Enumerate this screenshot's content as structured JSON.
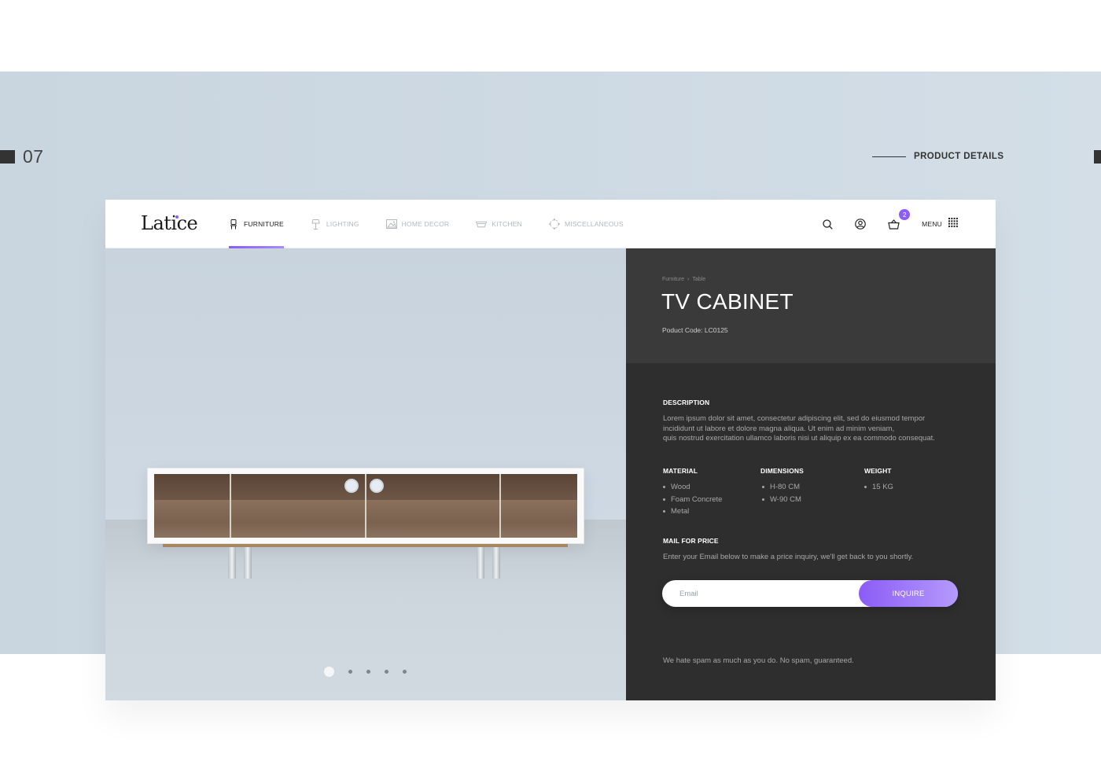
{
  "slide": {
    "number": "07",
    "section": "PRODUCT DETAILS"
  },
  "brand": {
    "logo": "Latice",
    "accent": "#8b5cf6"
  },
  "nav": [
    {
      "label": "FURNITURE",
      "icon": "chair-icon",
      "active": true
    },
    {
      "label": "LIGHTING",
      "icon": "lamp-icon",
      "active": false
    },
    {
      "label": "HOME DECOR",
      "icon": "picture-icon",
      "active": false
    },
    {
      "label": "KITCHEN",
      "icon": "bowl-icon",
      "active": false
    },
    {
      "label": "MISCELLANEOUS",
      "icon": "dots-circle-icon",
      "active": false
    }
  ],
  "tools": {
    "search_icon": "search-icon",
    "account_icon": "user-icon",
    "cart_icon": "basket-icon",
    "cart_count": "2",
    "menu_label": "MENU",
    "menu_icon": "grid-icon"
  },
  "product": {
    "breadcrumb": [
      "Furniture",
      "Table"
    ],
    "breadcrumb_sep": "›",
    "title": "TV CABINET",
    "code": "Poduct Code: LC0125",
    "description_heading": "DESCRIPTION",
    "description": [
      "Lorem ipsum dolor sit amet, consectetur adipiscing elit, sed  do eiusmod tempor",
      "incididunt ut labore et dolore magna aliqua. Ut enim ad minim veniam,",
      "quis nostrud exercitation ullamco laboris nisi ut aliquip ex ea commodo consequat."
    ],
    "specs": {
      "material": {
        "heading": "MATERIAL",
        "items": [
          "Wood",
          "Foam Concrete",
          "Metal"
        ]
      },
      "dimensions": {
        "heading": "DIMENSIONS",
        "items": [
          "H-80 CM",
          "W-90 CM"
        ]
      },
      "weight": {
        "heading": "WEIGHT",
        "items": [
          "15 KG"
        ]
      }
    },
    "mail_heading": "MAIL FOR PRICE",
    "mail_text": "Enter your Email below to make a price inquiry, we'll get back to you shortly.",
    "email_placeholder": "Email",
    "inquire_label": "INQUIRE",
    "spam_note": "We hate spam as much as you do. No spam, guaranteed."
  },
  "carousel": {
    "slides": 5,
    "active": 1
  }
}
